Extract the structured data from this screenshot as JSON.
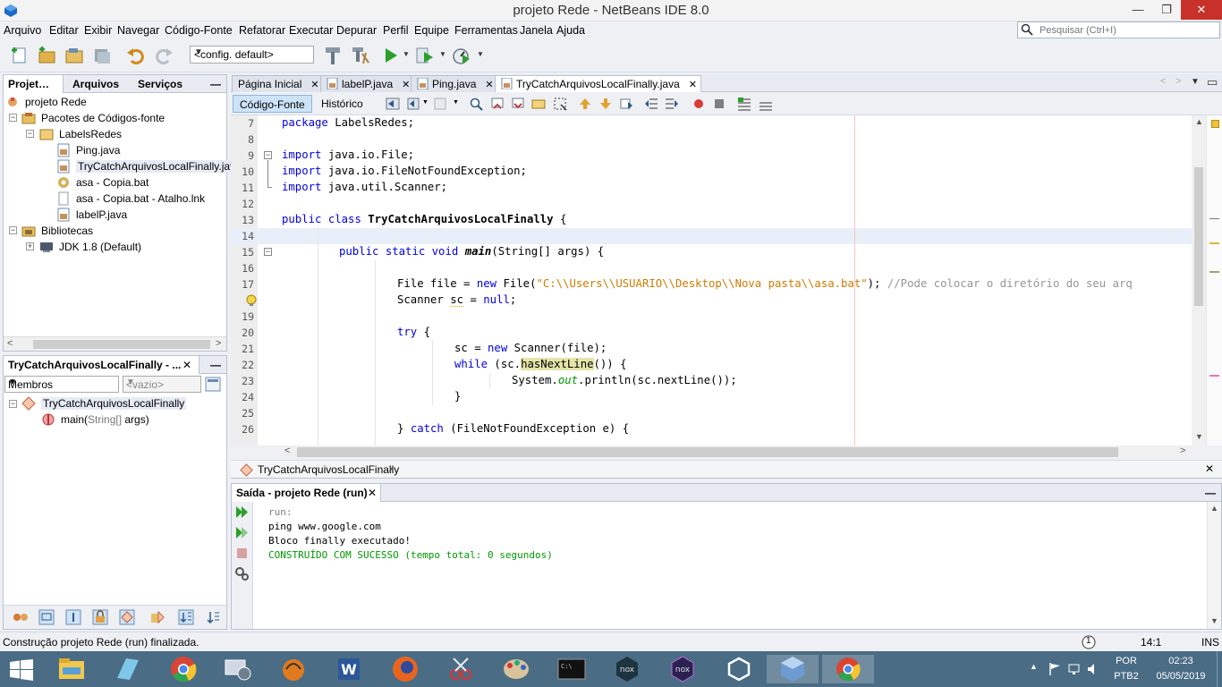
{
  "window": {
    "title": "projeto Rede - NetBeans IDE 8.0",
    "controls": {
      "minimize": "—",
      "maximize": "❐",
      "close": "✕"
    }
  },
  "menubar": {
    "items": [
      "Arquivo",
      "Editar",
      "Exibir",
      "Navegar",
      "Código-Fonte",
      "Refatorar",
      "Executar",
      "Depurar",
      "Perfil",
      "Equipe",
      "Ferramentas",
      "Janela",
      "Ajuda"
    ],
    "search_placeholder": "Pesquisar (Ctrl+I)"
  },
  "toolbar": {
    "config_value": "<config. default>"
  },
  "projects_panel": {
    "tabs": [
      "Projet…",
      "Arquivos",
      "Serviços"
    ],
    "minimize": "—",
    "tree": [
      {
        "label": "projeto Rede"
      },
      {
        "label": "Pacotes de Códigos-fonte"
      },
      {
        "label": "LabelsRedes"
      },
      {
        "label": "Ping.java"
      },
      {
        "label": "TryCatchArquivosLocalFinally.java"
      },
      {
        "label": "asa - Copia.bat"
      },
      {
        "label": "asa - Copia.bat - Atalho.lnk"
      },
      {
        "label": "labelP.java"
      },
      {
        "label": "Bibliotecas"
      },
      {
        "label": "JDK 1.8 (Default)"
      }
    ]
  },
  "navigator_panel": {
    "title": "TryCatchArquivosLocalFinally - ...",
    "close": "✕",
    "minimize": "—",
    "filter_value": "Membros",
    "scope_placeholder": "<vazio>",
    "class_name": "TryCatchArquivosLocalFinally",
    "member_name": "main(",
    "member_params": "String[]",
    "member_args": " args)"
  },
  "editor": {
    "tabs": [
      {
        "label": "Página Inicial"
      },
      {
        "label": "labelP.java"
      },
      {
        "label": "Ping.java"
      },
      {
        "label": "TryCatchArquivosLocalFinally.java"
      }
    ],
    "tab_close": "✕",
    "modes": [
      "Código-Fonte",
      "Histórico"
    ],
    "line_numbers": [
      "7",
      "8",
      "9",
      "10",
      "11",
      "12",
      "13",
      "14",
      "15",
      "16",
      "17",
      "18",
      "19",
      "20",
      "21",
      "22",
      "23",
      "24",
      "25",
      "26"
    ],
    "code": {
      "l7_kw": "package",
      "l7_rest": " LabelsRedes;",
      "l9_kw": "import",
      "l9_rest": " java.io.File;",
      "l10_kw": "import",
      "l10_rest": " java.io.FileNotFoundException;",
      "l11_kw": "import",
      "l11_rest": " java.util.Scanner;",
      "l13_kw1": "public",
      "l13_kw2": "class",
      "l13_cls": "TryCatchArquivosLocalFinally",
      "l13_rest": " {",
      "l15_kw1": "public",
      "l15_kw2": "static",
      "l15_kw3": "void",
      "l15_method": "main",
      "l15_rest": "(String[] args) {",
      "l17_a": "File file = ",
      "l17_kw": "new",
      "l17_b": " File(",
      "l17_str": "\"C:\\\\Users\\\\USUARIO\\\\Desktop\\\\Nova pasta\\\\asa.bat\"",
      "l17_c": "); ",
      "l17_cmt": "//Pode colocar o diretório do seu arq",
      "l18_a": "Scanner ",
      "l18_var": "sc",
      "l18_b": " = ",
      "l18_kw": "null",
      "l18_c": ";",
      "l20_kw": "try",
      "l20_rest": " {",
      "l21_a": "sc = ",
      "l21_kw": "new",
      "l21_b": " Scanner(file);",
      "l22_kw": "while",
      "l22_a": " (sc.",
      "l22_mark": "hasNextLine",
      "l22_b": "()) {",
      "l23_a": "System.",
      "l23_fld": "out",
      "l23_b": ".println(sc.nextLine());",
      "l24": "}",
      "l26_a": "} ",
      "l26_kw": "catch",
      "l26_b": " (FileNotFoundException e) {"
    }
  },
  "breadcrumb": {
    "item": "TryCatchArquivosLocalFinally",
    "close": "✕"
  },
  "output": {
    "title": "Saída - projeto Rede (run)",
    "close": "✕",
    "minimize": "—",
    "lines": [
      "run:",
      "ping www.google.com",
      "Bloco finally executado!",
      "CONSTRUÍDO COM SUCESSO (tempo total: 0 segundos)"
    ],
    "colors": {
      "meta": "#808080",
      "normal": "#000000",
      "success": "#009900"
    }
  },
  "statusbar": {
    "message": "Construção projeto Rede (run) finalizada.",
    "notif_count": "1",
    "position": "14:1",
    "mode": "INS"
  },
  "taskbar": {
    "lang": "POR",
    "layout": "PTB2",
    "time": "02:23",
    "date": "05/05/2019"
  },
  "colors": {
    "keyword": "#0000e6",
    "string": "#ce7b00",
    "comment": "#969696",
    "taskbar": "#4a6c85"
  }
}
